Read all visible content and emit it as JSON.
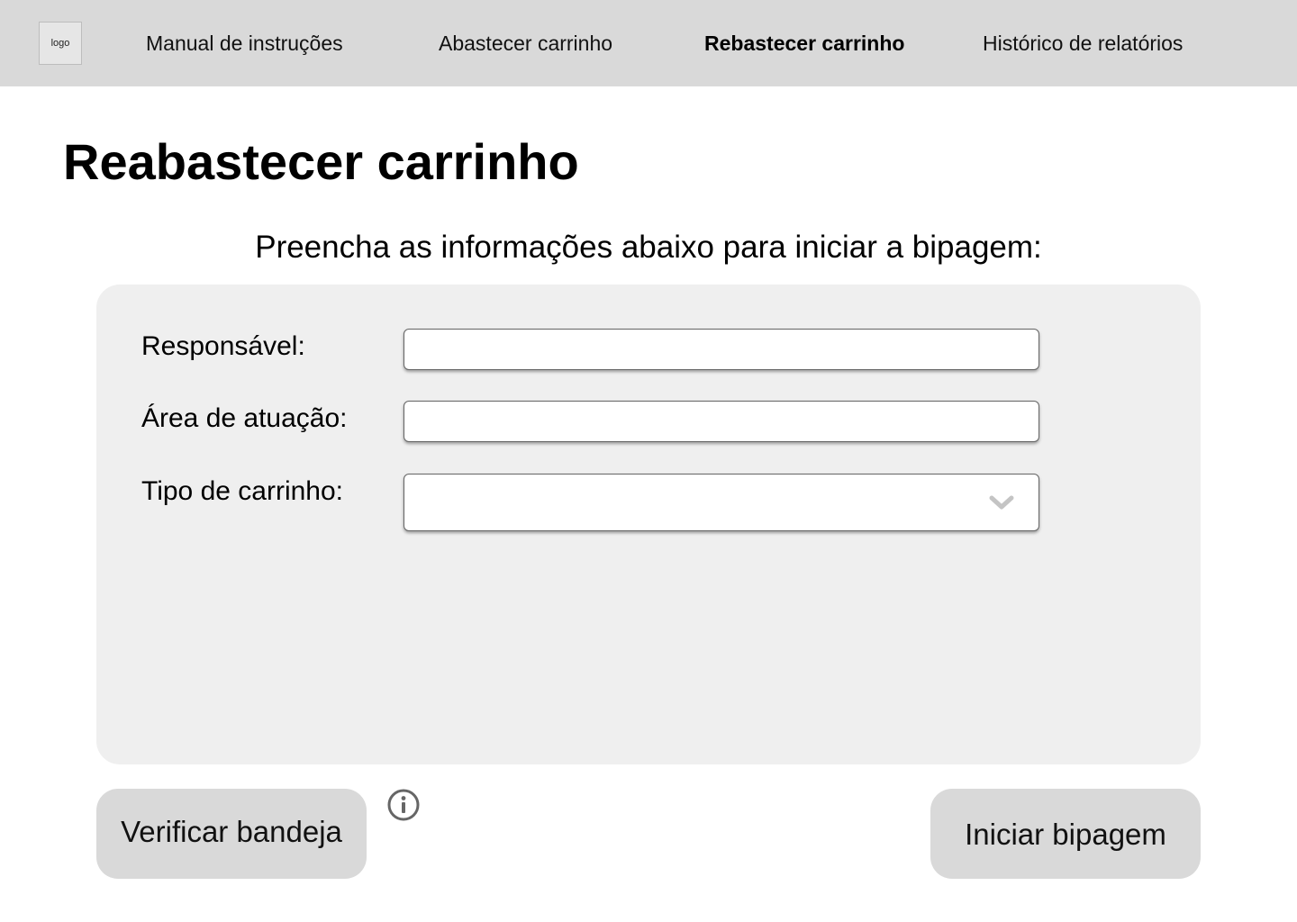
{
  "header": {
    "logo_text": "logo",
    "nav": [
      {
        "label": "Manual de instruções",
        "active": false
      },
      {
        "label": "Abastecer carrinho",
        "active": false
      },
      {
        "label": "Rebastecer carrinho",
        "active": true
      },
      {
        "label": "Histórico de relatórios",
        "active": false
      }
    ]
  },
  "main": {
    "title": "Reabastecer carrinho",
    "subtitle": "Preencha as informações abaixo para iniciar a bipagem:",
    "form": {
      "responsavel": {
        "label": "Responsável:",
        "value": "",
        "placeholder": ""
      },
      "area": {
        "label": "Área de atuação:",
        "value": "",
        "placeholder": ""
      },
      "tipo": {
        "label": "Tipo de carrinho:",
        "selected": ""
      }
    },
    "actions": {
      "verify_label": "Verificar bandeja",
      "start_label": "Iniciar bipagem"
    },
    "icons": {
      "info": "info-icon",
      "dropdown": "chevron-down-icon"
    }
  },
  "colors": {
    "topbar": "#d9d9d9",
    "panel": "#efefef",
    "button": "#d9d9d9",
    "chevron": "#c4c4c4",
    "info_icon": "#666666"
  }
}
